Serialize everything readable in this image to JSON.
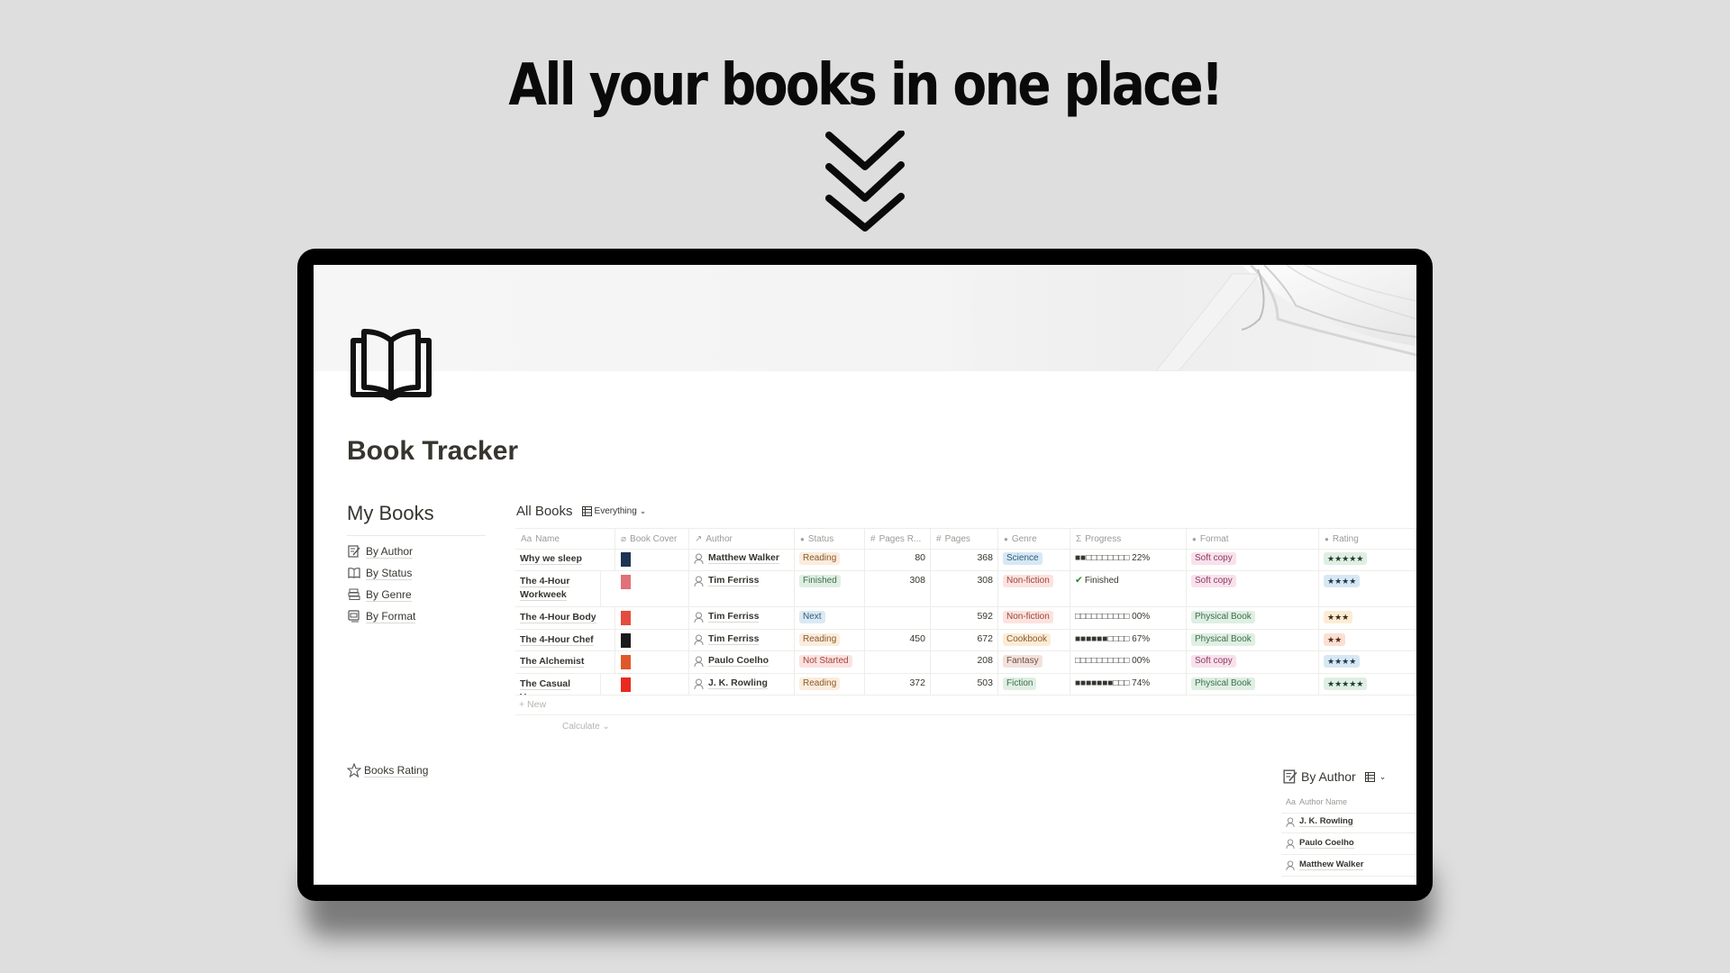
{
  "headline": "All your books in one place!",
  "page": {
    "title": "Book Tracker",
    "icon": "open-book-icon"
  },
  "sidebar": {
    "title": "My Books",
    "links": [
      {
        "label": "By Author",
        "icon": "author-list-icon"
      },
      {
        "label": "By Status",
        "icon": "status-book-icon"
      },
      {
        "label": "By Genre",
        "icon": "stacked-books-icon"
      },
      {
        "label": "By Format",
        "icon": "format-card-icon"
      }
    ],
    "rating_link": {
      "label": "Books Rating",
      "icon": "star-outline-icon"
    }
  },
  "database": {
    "title": "All Books",
    "view": {
      "label": "Everything",
      "icon": "table-icon"
    },
    "columns": [
      {
        "label": "Name",
        "icon": "Aa"
      },
      {
        "label": "Book Cover",
        "icon": "paperclip-icon"
      },
      {
        "label": "Author",
        "icon": "relation-arrow-icon"
      },
      {
        "label": "Status",
        "icon": "select-icon"
      },
      {
        "label": "Pages R...",
        "icon": "#"
      },
      {
        "label": "Pages",
        "icon": "#"
      },
      {
        "label": "Genre",
        "icon": "select-icon"
      },
      {
        "label": "Progress",
        "icon": "Σ"
      },
      {
        "label": "Format",
        "icon": "select-icon"
      },
      {
        "label": "Rating",
        "icon": "select-icon"
      }
    ],
    "rows": [
      {
        "name": "Why we sleep",
        "cover_color": "#1e3553",
        "author": "Matthew Walker",
        "status": "Reading",
        "pages_read": "80",
        "pages": "368",
        "genre": "Science",
        "progress": "■■□□□□□□□□ 22%",
        "format": "Soft copy",
        "rating": "★★★★★"
      },
      {
        "name": "The 4-Hour Workweek",
        "cover_color": "#e0707a",
        "author": "Tim Ferriss",
        "status": "Finished",
        "pages_read": "308",
        "pages": "308",
        "genre": "Non-fiction",
        "progress": "Finished",
        "format": "Soft copy",
        "rating": "★★★★"
      },
      {
        "name": "The 4-Hour Body",
        "cover_color": "#e34d3d",
        "author": "Tim Ferriss",
        "status": "Next",
        "pages_read": "",
        "pages": "592",
        "genre": "Non-fiction",
        "progress": "□□□□□□□□□□ 00%",
        "format": "Physical Book",
        "rating": "★★★"
      },
      {
        "name": "The 4-Hour Chef",
        "cover_color": "#1a1a1a",
        "author": "Tim Ferriss",
        "status": "Reading",
        "pages_read": "450",
        "pages": "672",
        "genre": "Cookbook",
        "progress": "■■■■■■□□□□ 67%",
        "format": "Physical Book",
        "rating": "★★"
      },
      {
        "name": "The Alchemist",
        "cover_color": "#e0582a",
        "author": "Paulo Coelho",
        "status": "Not Started",
        "pages_read": "",
        "pages": "208",
        "genre": "Fantasy",
        "progress": "□□□□□□□□□□ 00%",
        "format": "Soft copy",
        "rating": "★★★★"
      },
      {
        "name": "The Casual Vacancy",
        "cover_color": "#e82a1f",
        "author": "J. K. Rowling",
        "status": "Reading",
        "pages_read": "372",
        "pages": "503",
        "genre": "Fiction",
        "progress": "■■■■■■■□□□ 74%",
        "format": "Physical Book",
        "rating": "★★★★★"
      }
    ],
    "new_label": "+ New",
    "calculate_label": "Calculate ⌄"
  },
  "tag_colors": {
    "Reading": {
      "bg": "#fbecdd",
      "fg": "#8a5a2a"
    },
    "Finished": {
      "bg": "#dfefe3",
      "fg": "#3e6e4a"
    },
    "Next": {
      "bg": "#dbe9f3",
      "fg": "#2f5d82"
    },
    "Not Started": {
      "bg": "#fbe2e0",
      "fg": "#a2433a"
    },
    "Science": {
      "bg": "#d7e8f3",
      "fg": "#2f5d82"
    },
    "Non-fiction": {
      "bg": "#fbe3df",
      "fg": "#a2433a"
    },
    "Cookbook": {
      "bg": "#fcecd6",
      "fg": "#8a5a2a"
    },
    "Fantasy": {
      "bg": "#f1e2de",
      "fg": "#7a4b3a"
    },
    "Fiction": {
      "bg": "#dfefe3",
      "fg": "#3e6e4a"
    },
    "Soft copy": {
      "bg": "#f8e1ec",
      "fg": "#8d3d63"
    },
    "Physical Book": {
      "bg": "#dfefe3",
      "fg": "#3e6e4a"
    },
    "★★★★★": {
      "bg": "#dfefe3",
      "fg": "#1f3a2a"
    },
    "★★★★": {
      "bg": "#d7e8f3",
      "fg": "#1f3550"
    },
    "★★★": {
      "bg": "#fcecd6",
      "fg": "#3a2a10"
    },
    "★★": {
      "bg": "#fbe0d3",
      "fg": "#5a2a10"
    }
  },
  "by_author": {
    "title": "By Author",
    "view_icon": "table-icon",
    "column": "Author Name",
    "rows": [
      "J. K. Rowling",
      "Paulo Coelho",
      "Matthew Walker"
    ]
  }
}
